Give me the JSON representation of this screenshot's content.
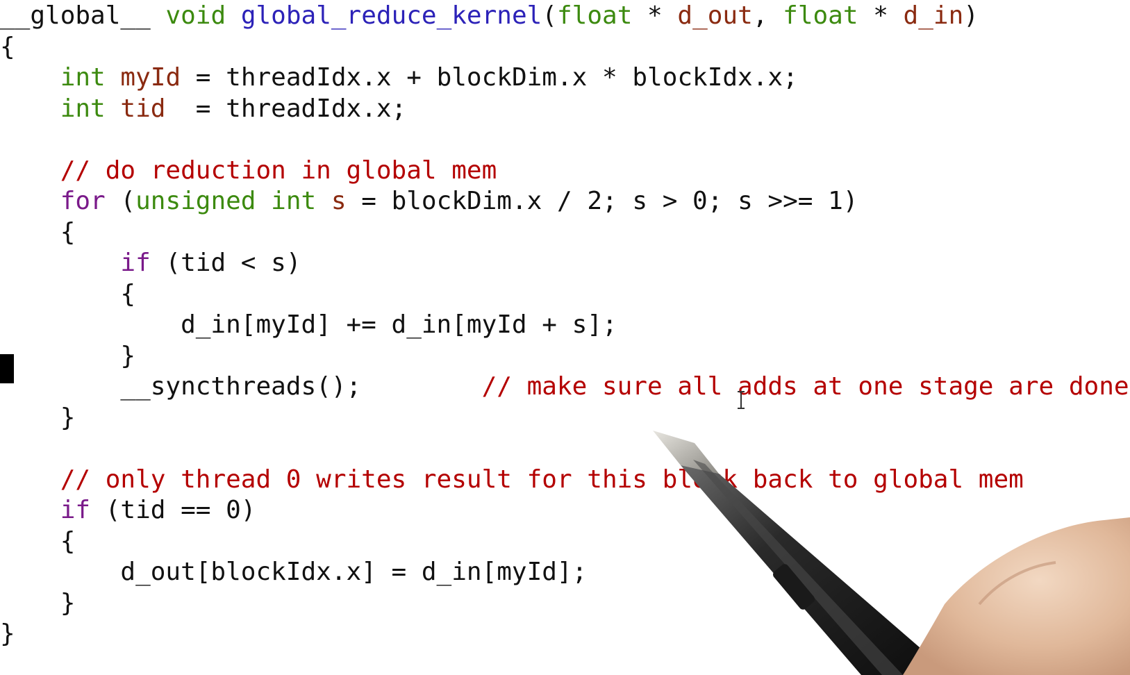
{
  "code": {
    "lines": [
      {
        "tokens": [
          {
            "text": "__global__",
            "style": "plain"
          },
          {
            "text": " ",
            "style": "plain"
          },
          {
            "text": "void",
            "style": "type"
          },
          {
            "text": " ",
            "style": "plain"
          },
          {
            "text": "global_reduce_kernel",
            "style": "func"
          },
          {
            "text": "(",
            "style": "plain"
          },
          {
            "text": "float",
            "style": "type"
          },
          {
            "text": " * ",
            "style": "plain"
          },
          {
            "text": "d_out",
            "style": "param"
          },
          {
            "text": ", ",
            "style": "plain"
          },
          {
            "text": "float",
            "style": "type"
          },
          {
            "text": " * ",
            "style": "plain"
          },
          {
            "text": "d_in",
            "style": "param"
          },
          {
            "text": ")",
            "style": "plain"
          }
        ]
      },
      {
        "tokens": [
          {
            "text": "{",
            "style": "plain"
          }
        ]
      },
      {
        "tokens": [
          {
            "text": "    ",
            "style": "plain"
          },
          {
            "text": "int",
            "style": "type"
          },
          {
            "text": " ",
            "style": "plain"
          },
          {
            "text": "myId",
            "style": "param"
          },
          {
            "text": " = threadIdx.x + blockDim.x * blockIdx.x;",
            "style": "plain"
          }
        ]
      },
      {
        "tokens": [
          {
            "text": "    ",
            "style": "plain"
          },
          {
            "text": "int",
            "style": "type"
          },
          {
            "text": " ",
            "style": "plain"
          },
          {
            "text": "tid",
            "style": "param"
          },
          {
            "text": "  = threadIdx.x;",
            "style": "plain"
          }
        ]
      },
      {
        "tokens": []
      },
      {
        "tokens": [
          {
            "text": "    ",
            "style": "plain"
          },
          {
            "text": "// do reduction in global mem",
            "style": "comment"
          }
        ]
      },
      {
        "tokens": [
          {
            "text": "    ",
            "style": "plain"
          },
          {
            "text": "for",
            "style": "kw"
          },
          {
            "text": " (",
            "style": "plain"
          },
          {
            "text": "unsigned int",
            "style": "type"
          },
          {
            "text": " ",
            "style": "plain"
          },
          {
            "text": "s",
            "style": "param"
          },
          {
            "text": " = blockDim.x / 2; s > 0; s >>= 1)",
            "style": "plain"
          }
        ]
      },
      {
        "tokens": [
          {
            "text": "    {",
            "style": "plain"
          }
        ]
      },
      {
        "tokens": [
          {
            "text": "        ",
            "style": "plain"
          },
          {
            "text": "if",
            "style": "kw"
          },
          {
            "text": " (tid < s)",
            "style": "plain"
          }
        ]
      },
      {
        "tokens": [
          {
            "text": "        {",
            "style": "plain"
          }
        ]
      },
      {
        "tokens": [
          {
            "text": "            d_in[myId] += d_in[myId + s];",
            "style": "plain"
          }
        ]
      },
      {
        "tokens": [
          {
            "text": "        }",
            "style": "plain"
          }
        ]
      },
      {
        "tokens": [
          {
            "text": "        __syncthreads();        ",
            "style": "plain"
          },
          {
            "text": "// make sure all adds at one stage are done!",
            "style": "comment"
          }
        ]
      },
      {
        "tokens": [
          {
            "text": "    }",
            "style": "plain"
          }
        ]
      },
      {
        "tokens": []
      },
      {
        "tokens": [
          {
            "text": "    ",
            "style": "plain"
          },
          {
            "text": "// only thread 0 writes result for this block back to global mem",
            "style": "comment"
          }
        ]
      },
      {
        "tokens": [
          {
            "text": "    ",
            "style": "plain"
          },
          {
            "text": "if",
            "style": "kw"
          },
          {
            "text": " (tid == 0)",
            "style": "plain"
          }
        ]
      },
      {
        "tokens": [
          {
            "text": "    {",
            "style": "plain"
          }
        ]
      },
      {
        "tokens": [
          {
            "text": "        d_out[blockIdx.x] = d_in[myId];",
            "style": "plain"
          }
        ]
      },
      {
        "tokens": [
          {
            "text": "    }",
            "style": "plain"
          }
        ]
      },
      {
        "tokens": [
          {
            "text": "}",
            "style": "plain"
          }
        ]
      }
    ]
  },
  "colors": {
    "background": "#ffffff",
    "plain": "#111111",
    "type": "#3c8a0f",
    "func": "#2c22b8",
    "param": "#8a2a10",
    "kw": "#7a1a8a",
    "comment": "#b40000"
  },
  "icons": {
    "margin_marker": "line-marker-icon",
    "cursor": "text-cursor-icon",
    "pen": "stylus-pen-icon"
  }
}
